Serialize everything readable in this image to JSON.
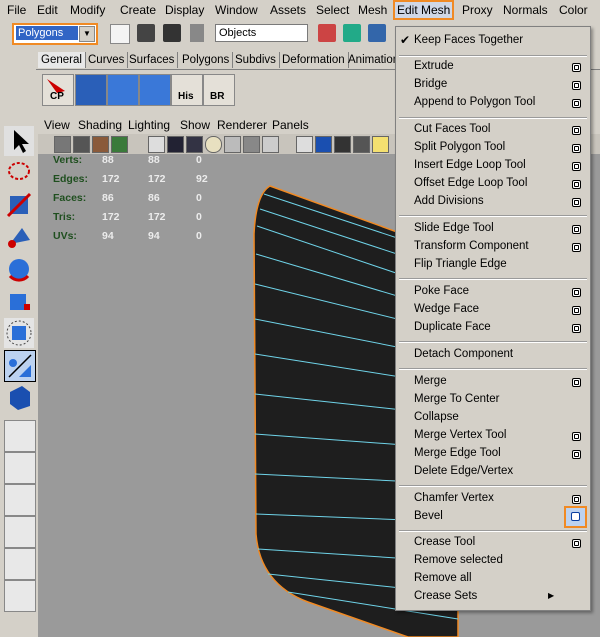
{
  "menubar": {
    "items": [
      "File",
      "Edit",
      "Modify",
      "Create",
      "Display",
      "Window",
      "Assets",
      "Select",
      "Mesh",
      "Edit Mesh",
      "Proxy",
      "Normals",
      "Color"
    ],
    "active": "Edit Mesh"
  },
  "toolbar": {
    "mode_select": "Polygons",
    "objects_field": "Objects"
  },
  "shelf": {
    "tabs": [
      "General",
      "Curves",
      "Surfaces",
      "Polygons",
      "Subdivs",
      "Deformation",
      "Animation"
    ],
    "icon_labels": [
      "CP",
      "His",
      "BR"
    ]
  },
  "viewport_menu": [
    "View",
    "Shading",
    "Lighting",
    "Show",
    "Renderer",
    "Panels"
  ],
  "hud": {
    "labels": [
      "Verts:",
      "Edges:",
      "Faces:",
      "Tris:",
      "UVs:"
    ],
    "rows": [
      [
        "88",
        "88",
        "0"
      ],
      [
        "172",
        "172",
        "92"
      ],
      [
        "86",
        "86",
        "0"
      ],
      [
        "172",
        "172",
        "0"
      ],
      [
        "94",
        "94",
        "0"
      ]
    ]
  },
  "edit_mesh_menu": {
    "keep_faces_together": "Keep Faces Together",
    "groups": [
      [
        "Extrude",
        "Bridge",
        "Append to Polygon Tool"
      ],
      [
        "Cut Faces Tool",
        "Split Polygon Tool",
        "Insert Edge Loop Tool",
        "Offset Edge Loop Tool",
        "Add Divisions"
      ],
      [
        "Slide Edge Tool",
        "Transform Component",
        "Flip Triangle Edge"
      ],
      [
        "Poke Face",
        "Wedge Face",
        "Duplicate Face"
      ],
      [
        "Detach Component"
      ],
      [
        "Merge",
        "Merge To Center",
        "Collapse",
        "Merge Vertex Tool",
        "Merge Edge Tool",
        "Delete Edge/Vertex"
      ],
      [
        "Chamfer Vertex",
        "Bevel"
      ],
      [
        "Crease Tool",
        "Remove selected",
        "Remove all",
        "Crease Sets"
      ]
    ]
  },
  "colors": {
    "highlight_orange": "#f08a24",
    "selection_blue": "#3165c5",
    "mesh_wire": "#6fd3e8",
    "mesh_face": "#1e1e1e",
    "viewport_bg": "#9a9a9a"
  }
}
